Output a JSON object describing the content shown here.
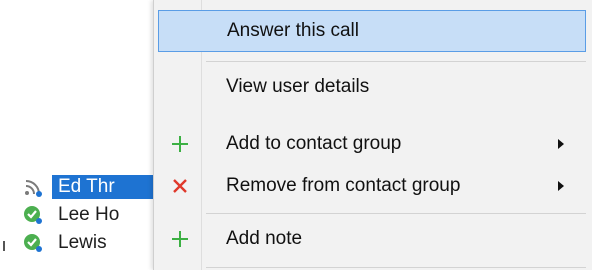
{
  "contacts": [
    {
      "name": "Ed Thr",
      "status": "ringing-icon",
      "selected": true
    },
    {
      "name": "Lee Ho",
      "status": "available-icon",
      "selected": false
    },
    {
      "name": "Lewis",
      "status": "available-icon",
      "selected": false
    }
  ],
  "menu": {
    "items": [
      {
        "label": "Answer this call",
        "icon": "",
        "submenu": false,
        "highlighted": true
      },
      {
        "label": "View user details",
        "icon": "",
        "submenu": false,
        "highlighted": false
      },
      {
        "label": "Add to contact group",
        "icon": "plus-icon",
        "submenu": true,
        "highlighted": false
      },
      {
        "label": "Remove from contact group",
        "icon": "close-icon",
        "submenu": true,
        "highlighted": false
      },
      {
        "label": "Add note",
        "icon": "plus-icon",
        "submenu": false,
        "highlighted": false
      }
    ]
  },
  "colors": {
    "selection": "#1e73d2",
    "menu_highlight": "#c7def7",
    "plus_icon": "#3cb043",
    "close_icon": "#e0392b",
    "available": "#4caf50"
  }
}
